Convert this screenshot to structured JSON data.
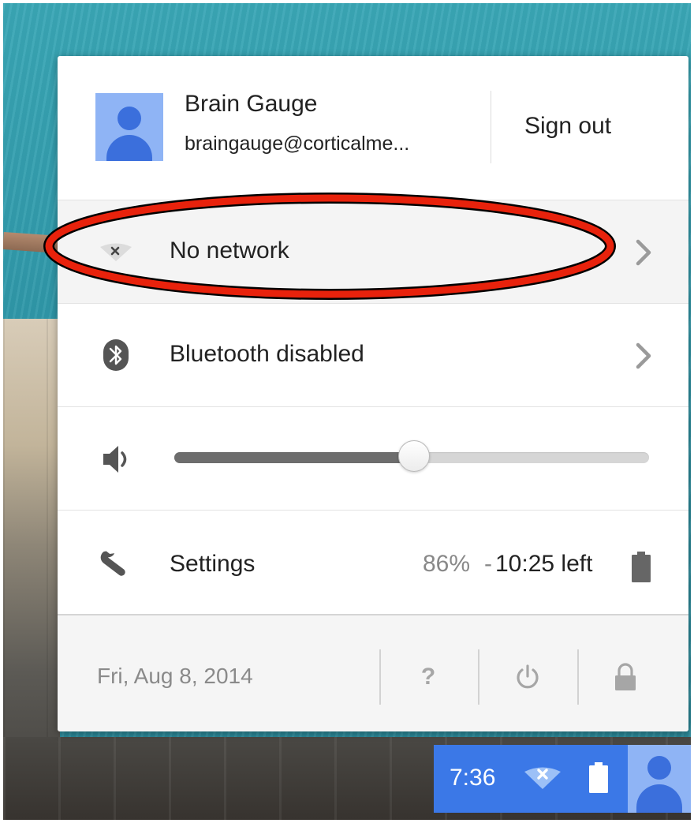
{
  "user": {
    "name": "Brain Gauge",
    "email": "braingauge@corticalme...",
    "sign_out_label": "Sign out"
  },
  "network": {
    "label": "No network",
    "icon": "wifi-disconnected-icon"
  },
  "bluetooth": {
    "label": "Bluetooth disabled",
    "icon": "bluetooth-icon"
  },
  "volume": {
    "icon": "speaker-icon",
    "level_percent": 50.5
  },
  "settings": {
    "label": "Settings",
    "icon": "wrench-icon"
  },
  "battery": {
    "percent": "86%",
    "separator": "-",
    "time_left": "10:25 left",
    "icon": "battery-icon"
  },
  "footer": {
    "date": "Fri, Aug 8, 2014",
    "help_label": "?",
    "help_icon": "help-icon",
    "power_icon": "power-icon",
    "lock_icon": "lock-icon"
  },
  "tray": {
    "time": "7:36",
    "network_icon": "wifi-disconnected-icon",
    "battery_icon": "battery-icon",
    "avatar_icon": "user-avatar-icon"
  },
  "colors": {
    "accent": "#3b78e7",
    "annotation": "#e8220c",
    "avatar_bg": "#8fb4f5",
    "avatar_fg": "#3b6fdc"
  }
}
